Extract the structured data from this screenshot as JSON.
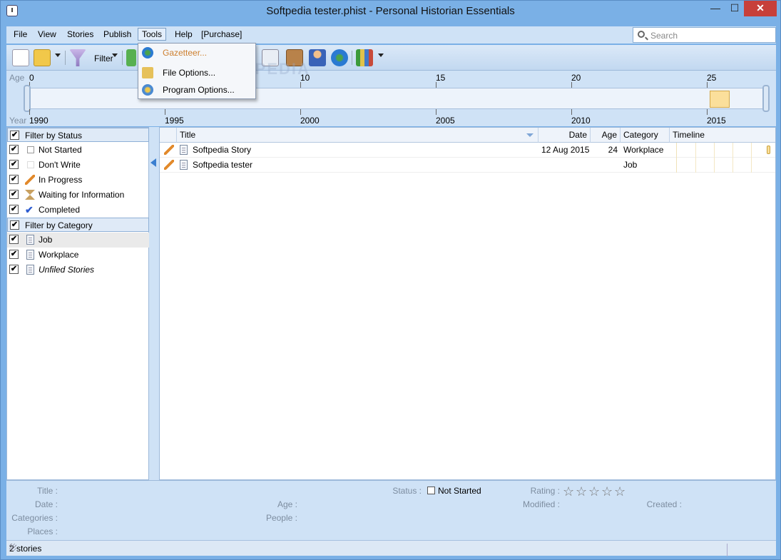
{
  "window": {
    "title": "Softpedia tester.phist - Personal Historian Essentials",
    "minimize": "—",
    "maximize": "☐",
    "close": "✕"
  },
  "menu": {
    "items": [
      "File",
      "View",
      "Stories",
      "Publish",
      "Tools",
      "Help",
      "[Purchase]"
    ],
    "active": "Tools"
  },
  "search": {
    "placeholder": "Search"
  },
  "toolbar": {
    "filter_label": "Filter"
  },
  "tools_menu": [
    {
      "label": "Gazetteer...",
      "enabled": false
    },
    {
      "label": "File Options...",
      "enabled": true
    },
    {
      "label": "Program Options...",
      "enabled": true
    }
  ],
  "watermark": "SOFTPEDIA",
  "timeline": {
    "age_caption": "Age",
    "year_caption": "Year",
    "age_ticks": [
      "0",
      "10",
      "15",
      "20",
      "25"
    ],
    "year_ticks": [
      "1990",
      "1995",
      "2000",
      "2005",
      "2010",
      "2015"
    ]
  },
  "filters": {
    "status_header": "Filter by Status",
    "status": [
      "Not Started",
      "Don't Write",
      "In Progress",
      "Waiting for Information",
      "Completed"
    ],
    "category_header": "Filter by Category",
    "categories": [
      "Job",
      "Workplace",
      "Unfiled Stories"
    ]
  },
  "table": {
    "columns": [
      "Title",
      "Date",
      "Age",
      "Category",
      "Timeline"
    ],
    "rows": [
      {
        "title": "Softpedia Story",
        "date": "12 Aug 2015",
        "age": "24",
        "category": "Workplace"
      },
      {
        "title": "Softpedia tester",
        "date": "",
        "age": "",
        "category": "Job"
      }
    ]
  },
  "details": {
    "title_label": "Title :",
    "date_label": "Date :",
    "categories_label": "Categories :",
    "places_label": "Places :",
    "age_label": "Age :",
    "people_label": "People :",
    "status_label": "Status :",
    "status_value": "Not Started",
    "rating_label": "Rating :",
    "modified_label": "Modified :",
    "created_label": "Created :",
    "rating": 0,
    "rating_max": 5,
    "star_glyph": "☆"
  },
  "statusbar": {
    "text": "2 stories"
  },
  "colors": {
    "accent": "#3b7fd0",
    "timeline_event": "#fbdf9b",
    "close_button": "#c7403a"
  }
}
